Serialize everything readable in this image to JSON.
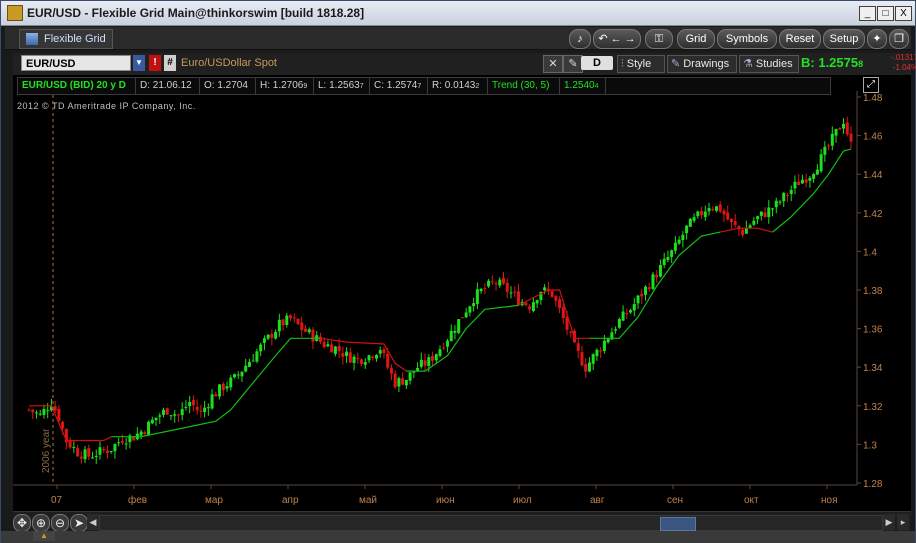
{
  "window": {
    "title": "EUR/USD - Flexible Grid Main@thinkorswim [build 1818.28]",
    "controls": {
      "minimize": "_",
      "maximize": "□",
      "close": "X"
    }
  },
  "toolbar": {
    "grid_tab": "Flexible Grid",
    "grid_btn": "Grid",
    "symbols_btn": "Symbols",
    "reset_btn": "Reset",
    "setup_btn": "Setup"
  },
  "chart_toolbar": {
    "symbol": "EUR/USD",
    "description": "Euro/USDollar Spot",
    "aggregation": "D",
    "style_label": "Style",
    "drawings_label": "Drawings",
    "studies_label": "Studies",
    "bid_label": "B:",
    "bid_main": "1.2575",
    "bid_small": "8",
    "change1": "-.01317",
    "change2": "-1.04%"
  },
  "infobar": {
    "title": "EUR/USD (BID) 20 y D",
    "date": "D: 21.06.12",
    "open": "O: 1.2704",
    "high_main": "H: 1.2706",
    "high_small": "9",
    "low_main": "L: 1.2563",
    "low_small": "7",
    "close_main": "C: 1.2574",
    "close_small": "7",
    "range_main": "R: 0.0143",
    "range_small": "2",
    "study_name": "Trend (30, 5)",
    "study_value_main": "1.2540",
    "study_value_small": "4"
  },
  "copyright": "2012 © TD Ameritrade IP Company, Inc.",
  "chart_data": {
    "type": "candlestick",
    "y_ticks": [
      "1.48",
      "1.46",
      "1.44",
      "1.42",
      "1.4",
      "1.38",
      "1.36",
      "1.34",
      "1.32",
      "1.3",
      "1.28"
    ],
    "ylim": [
      1.28,
      1.48
    ],
    "x_ticks": [
      "07",
      "фев",
      "мар",
      "апр",
      "май",
      "июн",
      "июл",
      "авг",
      "сен",
      "окт",
      "ноя"
    ],
    "year_marker": "2006 year",
    "colors": {
      "up": "#1de01d",
      "down": "#e01515",
      "trend": "#11c011",
      "trend_alt": "#d01010",
      "axis_text": "#c0824a",
      "grid_text": "#a0a0a0"
    },
    "close_path": [
      [
        0,
        1.318
      ],
      [
        3,
        1.315
      ],
      [
        6,
        1.322
      ],
      [
        8,
        1.314
      ],
      [
        10,
        1.302
      ],
      [
        13,
        1.296
      ],
      [
        16,
        1.294
      ],
      [
        19,
        1.296
      ],
      [
        22,
        1.298
      ],
      [
        25,
        1.303
      ],
      [
        28,
        1.304
      ],
      [
        31,
        1.308
      ],
      [
        34,
        1.314
      ],
      [
        37,
        1.318
      ],
      [
        40,
        1.315
      ],
      [
        43,
        1.322
      ],
      [
        46,
        1.316
      ],
      [
        49,
        1.325
      ],
      [
        52,
        1.33
      ],
      [
        55,
        1.334
      ],
      [
        58,
        1.341
      ],
      [
        61,
        1.348
      ],
      [
        64,
        1.355
      ],
      [
        67,
        1.362
      ],
      [
        70,
        1.365
      ],
      [
        73,
        1.36
      ],
      [
        76,
        1.356
      ],
      [
        79,
        1.352
      ],
      [
        82,
        1.35
      ],
      [
        85,
        1.346
      ],
      [
        88,
        1.344
      ],
      [
        91,
        1.346
      ],
      [
        94,
        1.35
      ],
      [
        96,
        1.34
      ],
      [
        98,
        1.332
      ],
      [
        101,
        1.334
      ],
      [
        104,
        1.34
      ],
      [
        107,
        1.343
      ],
      [
        110,
        1.35
      ],
      [
        113,
        1.358
      ],
      [
        116,
        1.367
      ],
      [
        119,
        1.376
      ],
      [
        122,
        1.381
      ],
      [
        125,
        1.384
      ],
      [
        128,
        1.38
      ],
      [
        131,
        1.375
      ],
      [
        134,
        1.372
      ],
      [
        137,
        1.38
      ],
      [
        140,
        1.378
      ],
      [
        143,
        1.365
      ],
      [
        146,
        1.35
      ],
      [
        149,
        1.34
      ],
      [
        152,
        1.348
      ],
      [
        155,
        1.356
      ],
      [
        158,
        1.364
      ],
      [
        161,
        1.37
      ],
      [
        164,
        1.378
      ],
      [
        167,
        1.386
      ],
      [
        170,
        1.394
      ],
      [
        173,
        1.402
      ],
      [
        176,
        1.412
      ],
      [
        179,
        1.418
      ],
      [
        182,
        1.424
      ],
      [
        185,
        1.422
      ],
      [
        188,
        1.414
      ],
      [
        191,
        1.41
      ],
      [
        194,
        1.416
      ],
      [
        197,
        1.42
      ],
      [
        200,
        1.424
      ],
      [
        203,
        1.43
      ],
      [
        206,
        1.436
      ],
      [
        209,
        1.44
      ],
      [
        212,
        1.448
      ],
      [
        215,
        1.458
      ],
      [
        218,
        1.468
      ],
      [
        220,
        1.455
      ]
    ],
    "trend_segments": [
      {
        "color": "red",
        "points": [
          [
            0,
            1.32
          ],
          [
            6,
            1.32
          ],
          [
            10,
            1.302
          ],
          [
            20,
            1.302
          ],
          [
            22,
            1.304
          ]
        ]
      },
      {
        "color": "green",
        "points": [
          [
            22,
            1.304
          ],
          [
            30,
            1.304
          ],
          [
            40,
            1.308
          ],
          [
            50,
            1.312
          ],
          [
            54,
            1.318
          ],
          [
            60,
            1.332
          ],
          [
            66,
            1.346
          ],
          [
            70,
            1.355
          ],
          [
            78,
            1.355
          ]
        ]
      },
      {
        "color": "red",
        "points": [
          [
            78,
            1.355
          ],
          [
            85,
            1.353
          ],
          [
            95,
            1.352
          ],
          [
            98,
            1.342
          ],
          [
            101,
            1.338
          ]
        ]
      },
      {
        "color": "green",
        "points": [
          [
            101,
            1.338
          ],
          [
            106,
            1.338
          ],
          [
            112,
            1.346
          ],
          [
            117,
            1.36
          ],
          [
            122,
            1.37
          ],
          [
            131,
            1.372
          ]
        ]
      },
      {
        "color": "red",
        "points": [
          [
            131,
            1.372
          ],
          [
            139,
            1.38
          ],
          [
            142,
            1.38
          ],
          [
            146,
            1.355
          ],
          [
            150,
            1.355
          ]
        ]
      },
      {
        "color": "green",
        "points": [
          [
            150,
            1.355
          ],
          [
            158,
            1.355
          ],
          [
            163,
            1.366
          ],
          [
            168,
            1.382
          ],
          [
            174,
            1.398
          ],
          [
            180,
            1.408
          ],
          [
            185,
            1.41
          ]
        ]
      },
      {
        "color": "red",
        "points": [
          [
            185,
            1.41
          ],
          [
            190,
            1.412
          ],
          [
            195,
            1.412
          ],
          [
            199,
            1.41
          ]
        ]
      },
      {
        "color": "green",
        "points": [
          [
            199,
            1.41
          ],
          [
            204,
            1.418
          ],
          [
            210,
            1.43
          ],
          [
            214,
            1.44
          ],
          [
            218,
            1.452
          ],
          [
            220,
            1.453
          ]
        ]
      }
    ]
  }
}
